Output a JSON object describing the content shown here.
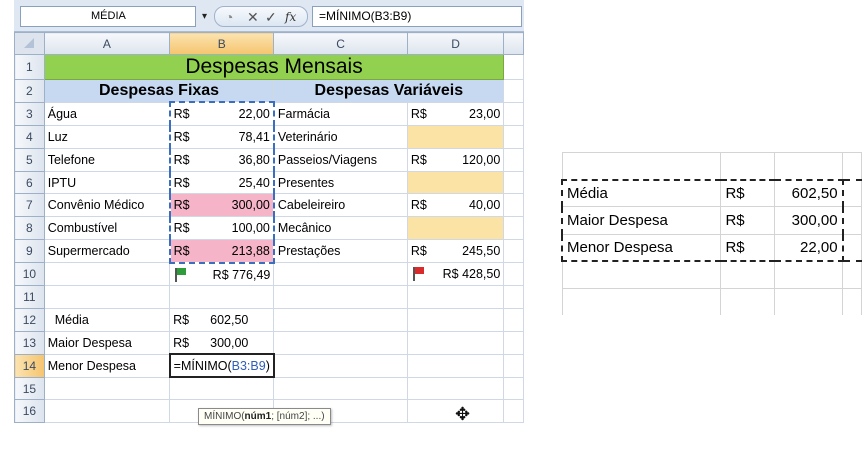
{
  "formula_bar": {
    "name_box": "MÉDIA",
    "name_box_arrow": "▾",
    "cancel_icon": "◔",
    "x_icon": "✕",
    "check_icon": "✓",
    "fx_label": "fx",
    "formula": "=MÍNIMO(B3:B9)"
  },
  "columns": [
    "A",
    "B",
    "C",
    "D"
  ],
  "rows": [
    "1",
    "2",
    "3",
    "4",
    "5",
    "6",
    "7",
    "8",
    "9",
    "10",
    "11",
    "12",
    "13",
    "14",
    "15",
    "16"
  ],
  "title": "Despesas Mensais",
  "headers": {
    "fixas": "Despesas Fixas",
    "variaveis": "Despesas Variáveis"
  },
  "currency": "R$",
  "fixed_expenses": [
    {
      "name": "Água",
      "value": "22,00"
    },
    {
      "name": "Luz",
      "value": "78,41"
    },
    {
      "name": "Telefone",
      "value": "36,80"
    },
    {
      "name": "IPTU",
      "value": "25,40"
    },
    {
      "name": "Convênio Médico",
      "value": "300,00"
    },
    {
      "name": "Combustível",
      "value": "100,00"
    },
    {
      "name": "Supermercado",
      "value": "213,88"
    }
  ],
  "variable_expenses": [
    {
      "name": "Farmácia",
      "value": "23,00"
    },
    {
      "name": "Veterinário",
      "value": ""
    },
    {
      "name": "Passeios/Viagens",
      "value": "120,00"
    },
    {
      "name": "Presentes",
      "value": ""
    },
    {
      "name": "Cabeleireiro",
      "value": "40,00"
    },
    {
      "name": "Mecânico",
      "value": ""
    },
    {
      "name": "Prestações",
      "value": "245,50"
    }
  ],
  "totals": {
    "fixas": "R$ 776,49",
    "variaveis": "R$ 428,50"
  },
  "stats": [
    {
      "label": "Média",
      "value": "602,50"
    },
    {
      "label": "Maior Despesa",
      "value": "300,00"
    },
    {
      "label": "Menor Despesa",
      "value": ""
    }
  ],
  "editing_cell": {
    "prefix": "=MÍNIMO(",
    "ref": "B3:B9",
    "suffix": ")"
  },
  "tooltip": {
    "fn": "MÍNIMO(",
    "arg1": "núm1",
    "rest": "; [núm2]; ...)"
  },
  "cursor_icon": "✥",
  "pasted_table": [
    {
      "label": "Média",
      "currency": "R$",
      "value": "602,50"
    },
    {
      "label": "Maior Despesa",
      "currency": "R$",
      "value": "300,00"
    },
    {
      "label": "Menor Despesa",
      "currency": "R$",
      "value": "22,00"
    }
  ]
}
